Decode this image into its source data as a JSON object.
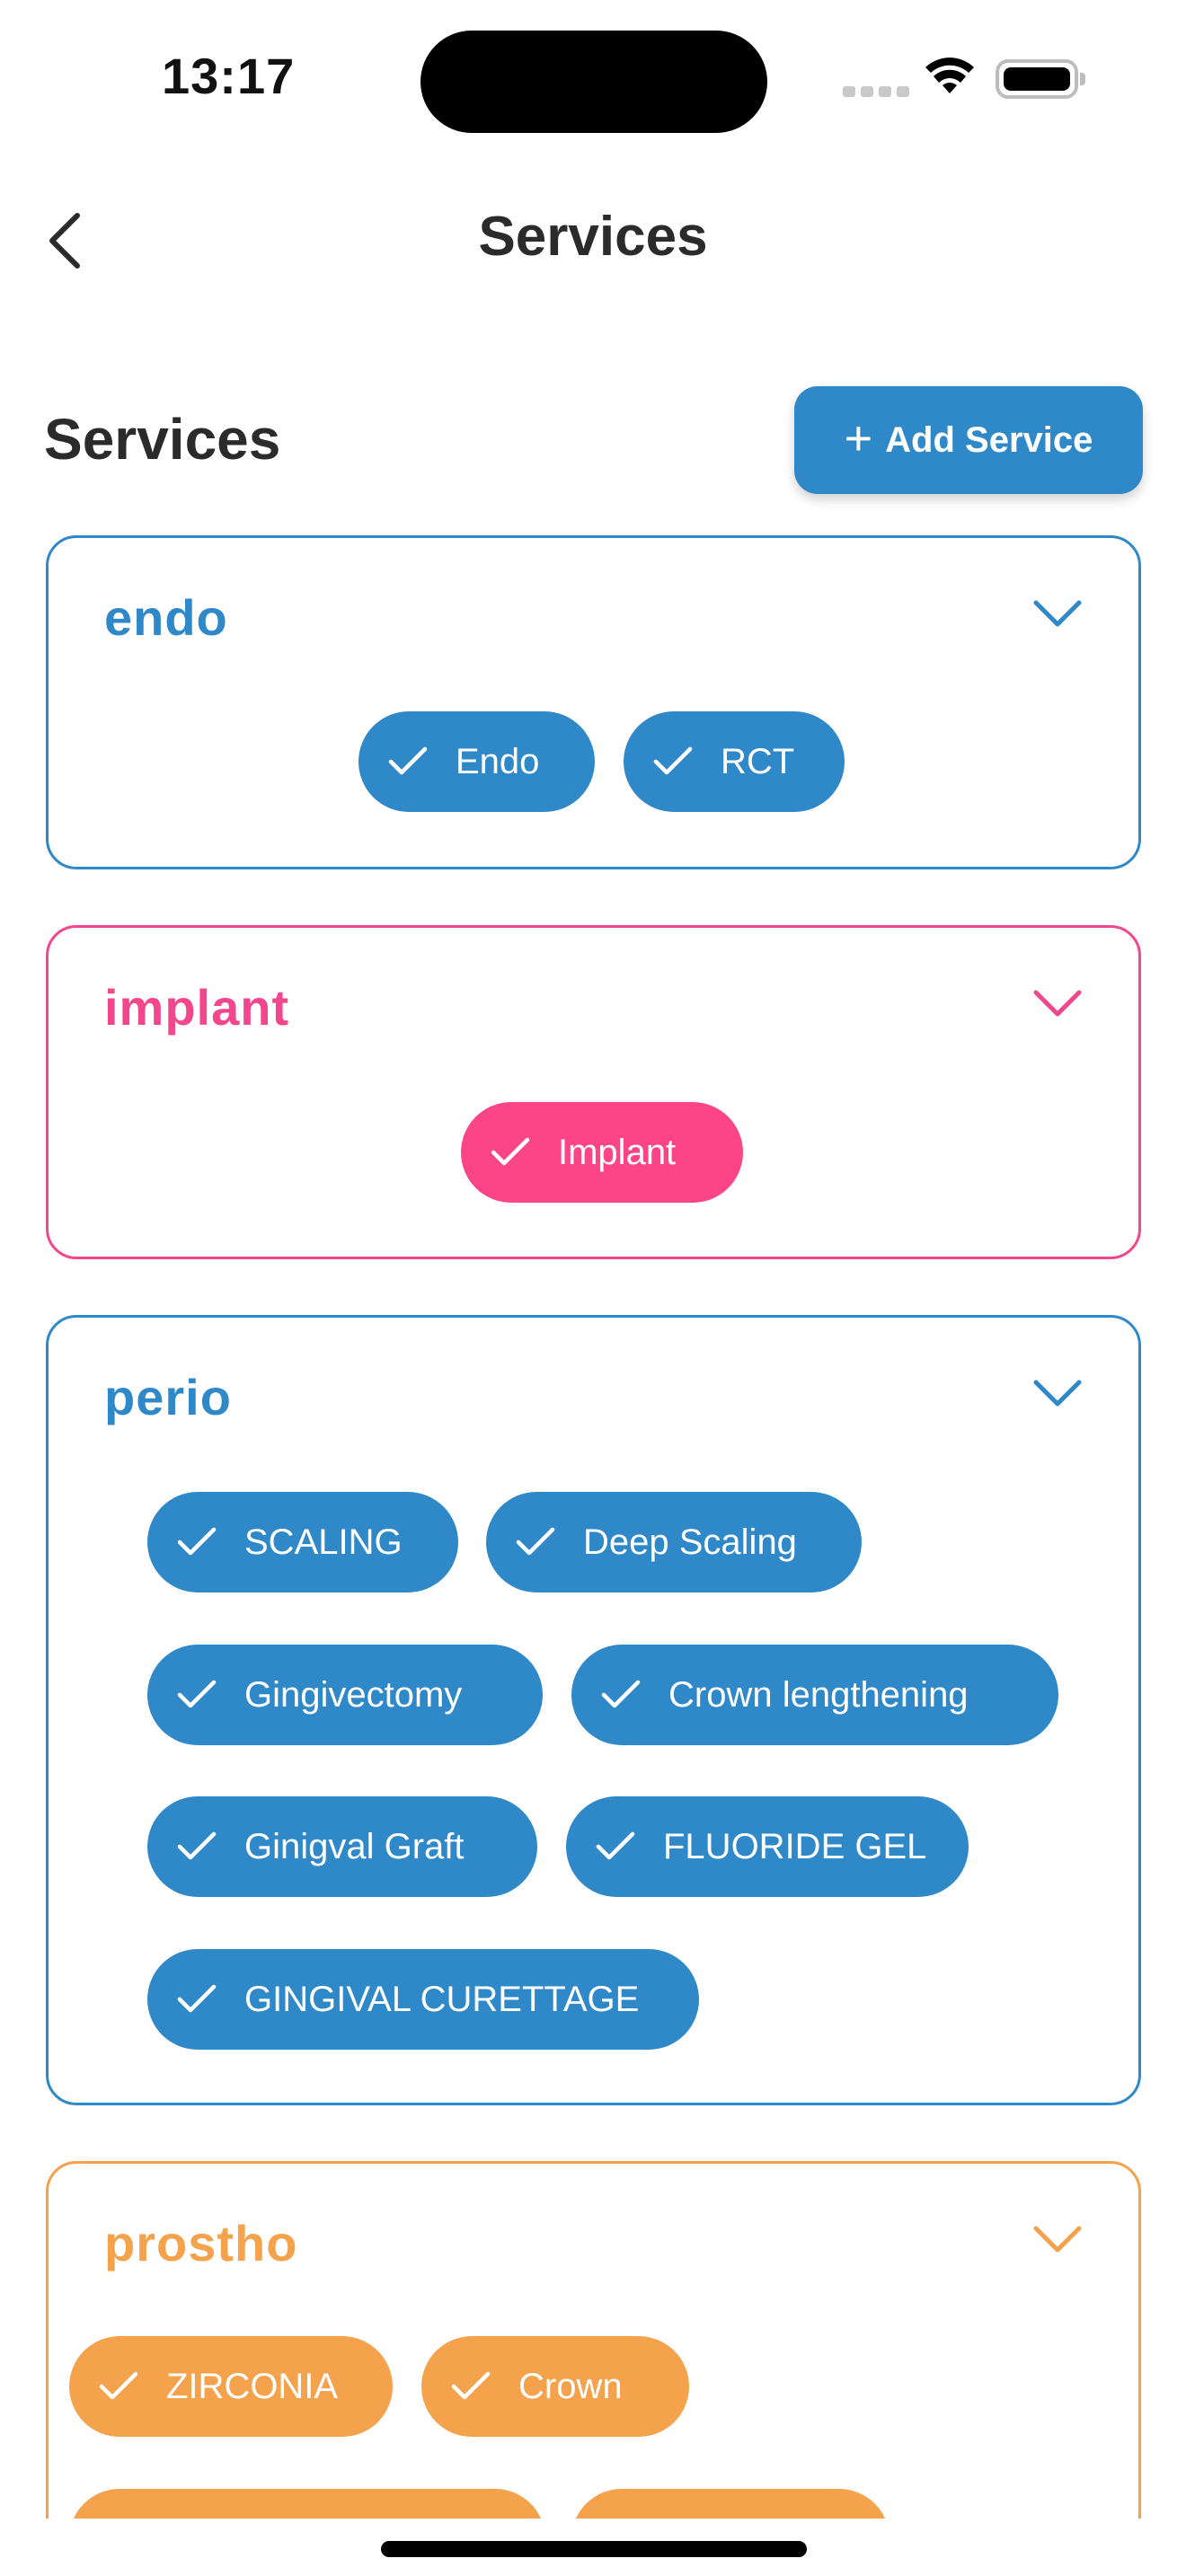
{
  "status_bar": {
    "time": "13:17"
  },
  "nav": {
    "title": "Services"
  },
  "header": {
    "title": "Services",
    "add_button": "Add Service"
  },
  "colors": {
    "blue": "#2f88c8",
    "pink": "#fc4587",
    "orange": "#f5a24c"
  },
  "categories": [
    {
      "name": "endo",
      "services": [
        "Endo",
        "RCT"
      ]
    },
    {
      "name": "implant",
      "services": [
        "Implant"
      ]
    },
    {
      "name": "perio",
      "services": [
        "SCALING",
        "Deep Scaling",
        "Gingivectomy",
        "Crown lengthening",
        "Ginigval Graft",
        "FLUORIDE GEL",
        "GINGIVAL CURETTAGE"
      ]
    },
    {
      "name": "prostho",
      "services": [
        "ZIRCONIA",
        "Crown"
      ]
    }
  ]
}
